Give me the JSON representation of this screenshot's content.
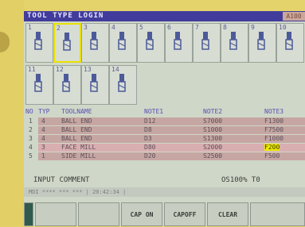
{
  "title": "TOOL TYPE LOGIN",
  "title_tag": "A100",
  "tools": [
    {
      "num": "1",
      "icon": "endmill-icon"
    },
    {
      "num": "2",
      "icon": "endmill-icon",
      "selected": true
    },
    {
      "num": "3",
      "icon": "drill-icon"
    },
    {
      "num": "4",
      "icon": "drill-icon"
    },
    {
      "num": "5",
      "icon": "boring-icon"
    },
    {
      "num": "6",
      "icon": "facemill-icon"
    },
    {
      "num": "7",
      "icon": "tap-icon"
    },
    {
      "num": "8",
      "icon": "drill-icon"
    },
    {
      "num": "9",
      "icon": "drill-icon"
    },
    {
      "num": "10",
      "icon": "chamfer-icon"
    },
    {
      "num": "11",
      "icon": "endmill-icon"
    },
    {
      "num": "12",
      "icon": "ballmill-icon"
    },
    {
      "num": "13",
      "icon": "sidemill-icon"
    },
    {
      "num": "14",
      "icon": "reamer-icon"
    }
  ],
  "table": {
    "headers": [
      "NO",
      "TYP",
      "TOOLNAME",
      "NOTE1",
      "NOTE2",
      "NOTE3"
    ],
    "rows": [
      {
        "no": "1",
        "typ": "4",
        "name": "BALL END",
        "note1": "D12",
        "note2": "S7000",
        "note3": "F1300"
      },
      {
        "no": "2",
        "typ": "4",
        "name": "BALL END",
        "note1": "D8",
        "note2": "S1000",
        "note3": "F7500"
      },
      {
        "no": "3",
        "typ": "4",
        "name": "BALL END",
        "note1": "D3",
        "note2": "S1300",
        "note3": "F1000"
      },
      {
        "no": "4",
        "typ": "3",
        "name": "FACE MILL",
        "note1": "D80",
        "note2": "S2000",
        "note3": "F200"
      },
      {
        "no": "5",
        "typ": "1",
        "name": "SIDE MILL",
        "note1": "D20",
        "note2": "S2500",
        "note3": "F500"
      }
    ]
  },
  "comment_label": "INPUT COMMENT",
  "coord": "OS100% T0",
  "status": "MDI **** *** ***   | 20:42:34 |",
  "softkeys": [
    "",
    "",
    "",
    "CAP ON",
    "CAPOFF",
    "CLEAR",
    ""
  ]
}
